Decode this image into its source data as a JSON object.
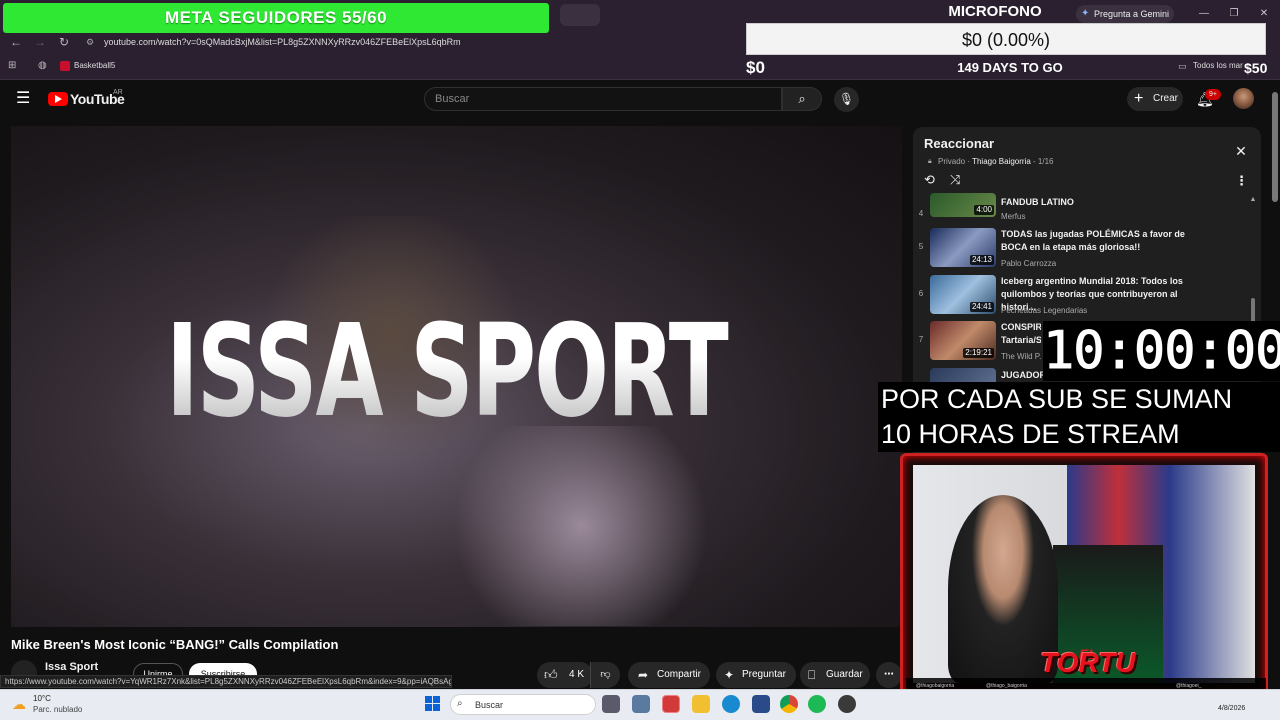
{
  "browser": {
    "url": "youtube.com/watch?v=0sQMadcBxjM&list=PL8g5ZXNNXyRRzv046ZFEBeElXpsL6qbRm",
    "bookmark": "Basketball5",
    "bookmarks_right": "Todos los mar",
    "gemini": "Pregunta a Gemini",
    "status_url": "https://www.youtube.com/watch?v=YqWR1Rz7Xnk&list=PL8g5ZXNNXyRRzv046ZFEBeElXpsL6qbRm&index=9&pp=iAQBsAgC"
  },
  "overlay": {
    "goal": "META SEGUIDORES 55/60",
    "donation_label": "MICROFONO",
    "donation_value": "$0 (0.00%)",
    "donation_min": "$0",
    "donation_max": "$50",
    "days_left": "149 DAYS TO GO",
    "timer": "10:00:00",
    "rule_line1": "POR CADA SUB SE SUMAN",
    "rule_line2": "10 HORAS DE STREAM",
    "logo_el": "EL",
    "logo_name": "TORTU",
    "social": [
      "@thiagobaigorria",
      "@thiago_baigorria",
      "@thiagoei_"
    ]
  },
  "youtube": {
    "wordmark": "YouTube",
    "country": "AR",
    "search_placeholder": "Buscar",
    "create": "Crear",
    "notifications": "9+"
  },
  "video": {
    "overlay_text": "ISSA SPORT",
    "title": "Mike Breen's Most Iconic “BANG!” Calls Compilation",
    "channel": "Issa Sport",
    "join": "Unirme",
    "subscribe": "Suscribirse",
    "likes": "4 K",
    "share": "Compartir",
    "ask": "Preguntar",
    "save": "Guardar"
  },
  "playlist": {
    "title": "Reaccionar",
    "privacy": "Privado",
    "owner": "Thiago Baigorria",
    "position": "1/16",
    "items": [
      {
        "index": "4",
        "title": "FANDUB LATINO",
        "channel": "Merfus",
        "duration": "4:00"
      },
      {
        "index": "5",
        "title": "TODAS las jugadas POLÉMICAS a favor de BOCA en la etapa más gloriosa!!",
        "channel": "Pablo Carrozza",
        "duration": "24:13"
      },
      {
        "index": "6",
        "title": "Iceberg argentino Mundial 2018: Todos los quilombos y teorías que contribuyeron al histori...",
        "channel": "Pecheadas Legendarias",
        "duration": "24:41"
      },
      {
        "index": "7",
        "title": "CONSPIR... Tartaria/S...",
        "channel": "The Wild P...",
        "duration": "2:19:21"
      },
      {
        "index": "8",
        "title": "JUGADOR...",
        "channel": "",
        "duration": ""
      }
    ]
  },
  "taskbar": {
    "temp": "10°C",
    "weather": "Parc. nublado",
    "search": "Buscar",
    "time": "",
    "date": "4/8/2026"
  }
}
